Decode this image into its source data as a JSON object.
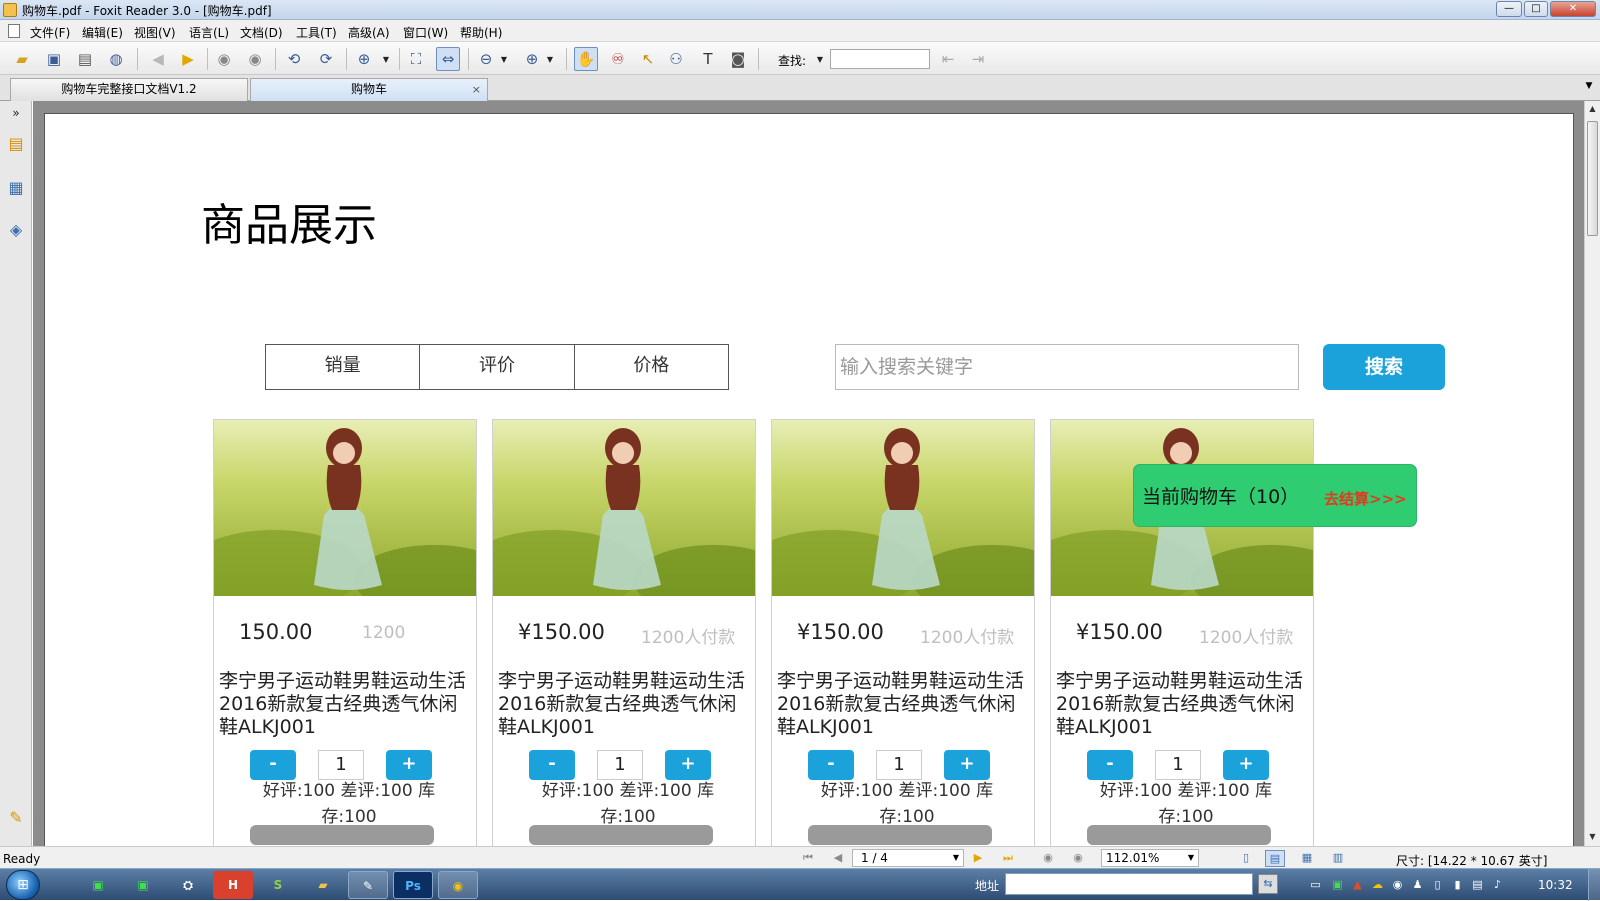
{
  "window": {
    "title": "购物车.pdf - Foxit Reader 3.0 - [购物车.pdf]",
    "minimize": "—",
    "maximize": "□",
    "close": "✕"
  },
  "menu": {
    "items": [
      "文件(F)",
      "编辑(E)",
      "视图(V)",
      "语言(L)",
      "文档(D)",
      "工具(T)",
      "高级(A)",
      "窗口(W)",
      "帮助(H)"
    ]
  },
  "toolbar": {
    "find_label": "查找:",
    "find_value": ""
  },
  "tabs": [
    {
      "label": "购物车完整接口文档V1.2",
      "active": false
    },
    {
      "label": "购物车",
      "active": true,
      "close": "×"
    }
  ],
  "document": {
    "page_title": "商品展示",
    "sort_buttons": [
      "销量",
      "评价",
      "价格"
    ],
    "search_placeholder": "输入搜索关键字",
    "search_button": "搜索",
    "cart": {
      "label": "当前购物车（10）",
      "checkout": "去结算>>>"
    },
    "products": [
      {
        "price": "150.00",
        "sold": "1200",
        "name": "李宁男子运动鞋男鞋运动生活2016新款复古经典透气休闲鞋ALKJ001",
        "minus": "-",
        "quantity": "1",
        "plus": "+",
        "stats": "好评:100 差评:100   库存:100"
      },
      {
        "price": "¥150.00",
        "sold": "1200人付款",
        "name": "李宁男子运动鞋男鞋运动生活2016新款复古经典透气休闲鞋ALKJ001",
        "minus": "-",
        "quantity": "1",
        "plus": "+",
        "stats": "好评:100 差评:100   库存:100"
      },
      {
        "price": "¥150.00",
        "sold": "1200人付款",
        "name": "李宁男子运动鞋男鞋运动生活2016新款复古经典透气休闲鞋ALKJ001",
        "minus": "-",
        "quantity": "1",
        "plus": "+",
        "stats": "好评:100 差评:100   库存:100"
      },
      {
        "price": "¥150.00",
        "sold": "1200人付款",
        "name": "李宁男子运动鞋男鞋运动生活2016新款复古经典透气休闲鞋ALKJ001",
        "minus": "-",
        "quantity": "1",
        "plus": "+",
        "stats": "好评:100 差评:100   库存:100"
      }
    ]
  },
  "statusbar": {
    "status": "Ready",
    "page": "1 / 4",
    "zoom": "112.01%",
    "size": "尺寸: [14.22 * 10.67 英寸]"
  },
  "taskbar": {
    "address_label": "地址",
    "clock": "10:32"
  },
  "colors": {
    "accent_blue": "#1ba2da",
    "cart_green": "#2fcc71",
    "checkout_red": "#e23a1c"
  }
}
